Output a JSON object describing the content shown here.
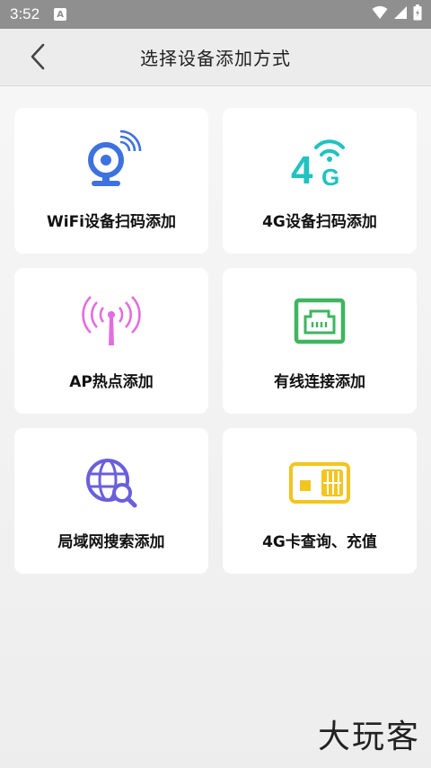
{
  "status_bar": {
    "time": "3:52",
    "notification_badge": "A"
  },
  "header": {
    "title": "选择设备添加方式"
  },
  "cards": [
    {
      "label": "WiFi设备扫码添加",
      "icon": "wifi-camera-icon",
      "color": "#3d72e0"
    },
    {
      "label": "4G设备扫码添加",
      "icon": "4g-signal-icon",
      "color": "#20c3c0"
    },
    {
      "label": "AP热点添加",
      "icon": "ap-hotspot-icon",
      "color": "#e46ce0"
    },
    {
      "label": "有线连接添加",
      "icon": "ethernet-port-icon",
      "color": "#3fb560"
    },
    {
      "label": "局域网搜索添加",
      "icon": "lan-search-icon",
      "color": "#6a5fdc"
    },
    {
      "label": "4G卡查询、充值",
      "icon": "sim-card-icon",
      "color": "#f3c51f"
    }
  ],
  "watermark": "大玩客"
}
